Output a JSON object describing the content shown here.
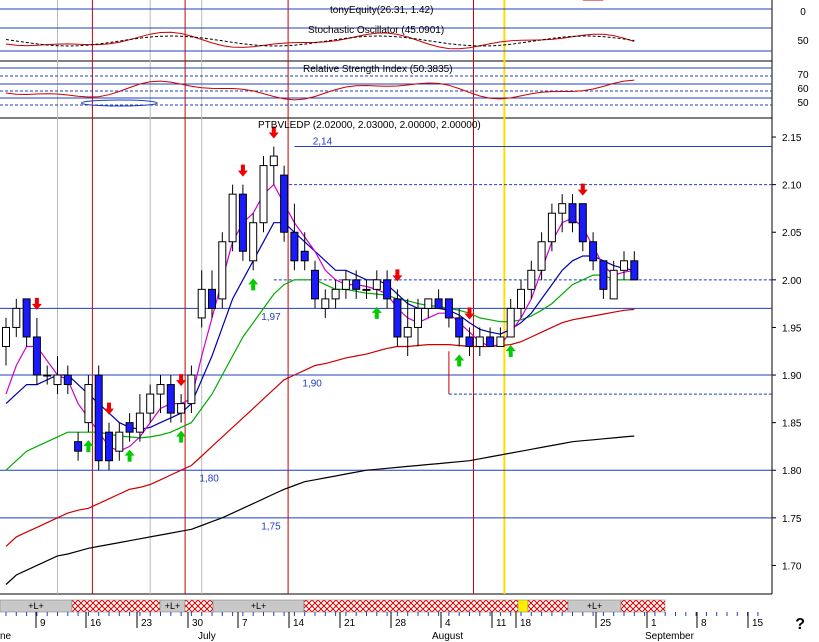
{
  "panels": {
    "equity": {
      "title": "tonyEquity(26.31, 1.42)",
      "scale": [
        "0"
      ]
    },
    "stochastic": {
      "title": "Stochastic Oscillator (45.0901)",
      "scale": [
        "50"
      ]
    },
    "rsi": {
      "title": "Relative Strength Index (50.3835)",
      "scale": [
        "70",
        "60",
        "50"
      ]
    }
  },
  "price_panel": {
    "title": "PTBVLEDP (2.02000, 2.03000, 2.00000, 2.00000)",
    "scale": [
      "2.15",
      "2.10",
      "2.05",
      "2.00",
      "1.95",
      "1.90",
      "1.85",
      "1.80",
      "1.75",
      "1.70"
    ]
  },
  "annotations": [
    {
      "text": "2,14",
      "x_index": 29,
      "y": 2.142
    },
    {
      "text": "1,97",
      "x_index": 24,
      "y": 1.958
    },
    {
      "text": "1,90",
      "x_index": 28,
      "y": 1.888
    },
    {
      "text": "1,80",
      "x_index": 18,
      "y": 1.788
    },
    {
      "text": "1,75",
      "x_index": 24,
      "y": 1.738
    }
  ],
  "date_axis": {
    "day_labels": [
      "9",
      "16",
      "23",
      "30",
      "7",
      "14",
      "21",
      "28",
      "4",
      "11",
      "18",
      "25",
      "1",
      "8",
      "15"
    ],
    "month_labels": [
      "ne",
      "July",
      "August",
      "September"
    ],
    "question_mark": "?"
  },
  "trade_bar": {
    "long_label": "+L+"
  },
  "colors": {
    "up": "#ffffff",
    "down": "#1a1aff",
    "up_arrow": "#00cc00",
    "down_arrow": "#ee0000",
    "ma_black": "#000000",
    "ma_red": "#cc0000",
    "ma_green": "#00aa00",
    "ma_blue": "#0000aa",
    "ma_magenta": "#cc00cc"
  },
  "chart_data": {
    "type": "candlestick",
    "title": "PTBVLEDP (2.02000, 2.03000, 2.00000, 2.00000)",
    "ylim": [
      1.67,
      2.17
    ],
    "horizontal_levels": [
      2.14,
      2.1,
      2.0,
      1.97,
      1.9,
      1.88,
      1.8,
      1.75
    ],
    "candles": [
      {
        "o": 1.93,
        "h": 1.96,
        "l": 1.91,
        "c": 1.95
      },
      {
        "o": 1.95,
        "h": 1.98,
        "l": 1.94,
        "c": 1.97
      },
      {
        "o": 1.98,
        "h": 1.98,
        "l": 1.93,
        "c": 1.94
      },
      {
        "o": 1.94,
        "h": 1.96,
        "l": 1.89,
        "c": 1.9
      },
      {
        "o": 1.9,
        "h": 1.91,
        "l": 1.89,
        "c": 1.9
      },
      {
        "o": 1.89,
        "h": 1.92,
        "l": 1.88,
        "c": 1.9
      },
      {
        "o": 1.9,
        "h": 1.91,
        "l": 1.88,
        "c": 1.89
      },
      {
        "o": 1.83,
        "h": 1.84,
        "l": 1.81,
        "c": 1.82
      },
      {
        "o": 1.85,
        "h": 1.9,
        "l": 1.84,
        "c": 1.89
      },
      {
        "o": 1.9,
        "h": 1.91,
        "l": 1.8,
        "c": 1.81
      },
      {
        "o": 1.84,
        "h": 1.85,
        "l": 1.8,
        "c": 1.81
      },
      {
        "o": 1.82,
        "h": 1.85,
        "l": 1.81,
        "c": 1.84
      },
      {
        "o": 1.85,
        "h": 1.86,
        "l": 1.83,
        "c": 1.84
      },
      {
        "o": 1.84,
        "h": 1.88,
        "l": 1.83,
        "c": 1.86
      },
      {
        "o": 1.86,
        "h": 1.89,
        "l": 1.85,
        "c": 1.88
      },
      {
        "o": 1.88,
        "h": 1.9,
        "l": 1.86,
        "c": 1.89
      },
      {
        "o": 1.89,
        "h": 1.9,
        "l": 1.85,
        "c": 1.86
      },
      {
        "o": 1.86,
        "h": 1.88,
        "l": 1.85,
        "c": 1.87
      },
      {
        "o": 1.87,
        "h": 1.91,
        "l": 1.86,
        "c": 1.9
      },
      {
        "o": 1.96,
        "h": 2.01,
        "l": 1.95,
        "c": 1.99
      },
      {
        "o": 1.99,
        "h": 2.01,
        "l": 1.96,
        "c": 1.97
      },
      {
        "o": 1.98,
        "h": 2.05,
        "l": 1.97,
        "c": 2.04
      },
      {
        "o": 2.04,
        "h": 2.1,
        "l": 2.03,
        "c": 2.09
      },
      {
        "o": 2.09,
        "h": 2.1,
        "l": 2.02,
        "c": 2.03
      },
      {
        "o": 2.02,
        "h": 2.07,
        "l": 2.01,
        "c": 2.06
      },
      {
        "o": 2.06,
        "h": 2.13,
        "l": 2.05,
        "c": 2.12
      },
      {
        "o": 2.12,
        "h": 2.14,
        "l": 2.1,
        "c": 2.13
      },
      {
        "o": 2.11,
        "h": 2.12,
        "l": 2.04,
        "c": 2.05
      },
      {
        "o": 2.05,
        "h": 2.08,
        "l": 2.01,
        "c": 2.02
      },
      {
        "o": 2.03,
        "h": 2.05,
        "l": 2.01,
        "c": 2.02
      },
      {
        "o": 2.01,
        "h": 2.02,
        "l": 1.97,
        "c": 1.98
      },
      {
        "o": 1.97,
        "h": 1.99,
        "l": 1.96,
        "c": 1.98
      },
      {
        "o": 1.98,
        "h": 2.0,
        "l": 1.97,
        "c": 1.99
      },
      {
        "o": 1.99,
        "h": 2.01,
        "l": 1.98,
        "c": 2.0
      },
      {
        "o": 2.0,
        "h": 2.01,
        "l": 1.98,
        "c": 1.99
      },
      {
        "o": 1.99,
        "h": 2.0,
        "l": 1.98,
        "c": 1.99
      },
      {
        "o": 1.99,
        "h": 2.01,
        "l": 1.98,
        "c": 2.0
      },
      {
        "o": 2.0,
        "h": 2.01,
        "l": 1.97,
        "c": 1.98
      },
      {
        "o": 1.98,
        "h": 1.99,
        "l": 1.93,
        "c": 1.94
      },
      {
        "o": 1.94,
        "h": 1.98,
        "l": 1.92,
        "c": 1.95
      },
      {
        "o": 1.95,
        "h": 1.98,
        "l": 1.93,
        "c": 1.97
      },
      {
        "o": 1.97,
        "h": 1.98,
        "l": 1.96,
        "c": 1.98
      },
      {
        "o": 1.98,
        "h": 1.99,
        "l": 1.97,
        "c": 1.97
      },
      {
        "o": 1.98,
        "h": 1.98,
        "l": 1.95,
        "c": 1.96
      },
      {
        "o": 1.96,
        "h": 1.97,
        "l": 1.93,
        "c": 1.94
      },
      {
        "o": 1.94,
        "h": 1.95,
        "l": 1.92,
        "c": 1.93
      },
      {
        "o": 1.93,
        "h": 1.95,
        "l": 1.92,
        "c": 1.94
      },
      {
        "o": 1.94,
        "h": 1.95,
        "l": 1.93,
        "c": 1.93
      },
      {
        "o": 1.93,
        "h": 1.95,
        "l": 1.93,
        "c": 1.94
      },
      {
        "o": 1.94,
        "h": 1.98,
        "l": 1.94,
        "c": 1.97
      },
      {
        "o": 1.97,
        "h": 2.0,
        "l": 1.96,
        "c": 1.99
      },
      {
        "o": 1.99,
        "h": 2.02,
        "l": 1.98,
        "c": 2.01
      },
      {
        "o": 2.01,
        "h": 2.05,
        "l": 2.0,
        "c": 2.04
      },
      {
        "o": 2.04,
        "h": 2.08,
        "l": 2.03,
        "c": 2.07
      },
      {
        "o": 2.07,
        "h": 2.09,
        "l": 2.05,
        "c": 2.08
      },
      {
        "o": 2.08,
        "h": 2.09,
        "l": 2.05,
        "c": 2.06
      },
      {
        "o": 2.08,
        "h": 2.08,
        "l": 2.03,
        "c": 2.04
      },
      {
        "o": 2.04,
        "h": 2.05,
        "l": 2.01,
        "c": 2.02
      },
      {
        "o": 2.02,
        "h": 2.02,
        "l": 1.98,
        "c": 1.99
      },
      {
        "o": 1.98,
        "h": 2.02,
        "l": 1.98,
        "c": 2.01
      },
      {
        "o": 2.01,
        "h": 2.03,
        "l": 2.0,
        "c": 2.02
      },
      {
        "o": 2.02,
        "h": 2.03,
        "l": 2.0,
        "c": 2.0
      }
    ],
    "up_arrows": [
      8,
      12,
      17,
      24,
      36,
      44,
      49
    ],
    "down_arrows": [
      3,
      10,
      17,
      23,
      26,
      38,
      45,
      56
    ],
    "vertical_markers_red": [
      8,
      17,
      27,
      45
    ],
    "vertical_marker_yellow": 48,
    "ma_black": [
      1.68,
      1.69,
      1.695,
      1.7,
      1.705,
      1.71,
      1.712,
      1.715,
      1.718,
      1.72,
      1.722,
      1.724,
      1.726,
      1.728,
      1.73,
      1.732,
      1.734,
      1.736,
      1.738,
      1.742,
      1.746,
      1.75,
      1.755,
      1.76,
      1.765,
      1.77,
      1.775,
      1.78,
      1.784,
      1.788,
      1.79,
      1.792,
      1.794,
      1.796,
      1.798,
      1.8,
      1.801,
      1.802,
      1.803,
      1.804,
      1.805,
      1.806,
      1.807,
      1.808,
      1.809,
      1.81,
      1.812,
      1.814,
      1.816,
      1.818,
      1.82,
      1.822,
      1.824,
      1.826,
      1.828,
      1.83,
      1.831,
      1.832,
      1.833,
      1.834,
      1.835,
      1.836
    ],
    "ma_red": [
      1.72,
      1.73,
      1.735,
      1.74,
      1.745,
      1.75,
      1.755,
      1.758,
      1.76,
      1.765,
      1.77,
      1.775,
      1.78,
      1.782,
      1.785,
      1.79,
      1.795,
      1.8,
      1.805,
      1.815,
      1.825,
      1.835,
      1.845,
      1.855,
      1.865,
      1.875,
      1.885,
      1.895,
      1.9,
      1.905,
      1.91,
      1.912,
      1.915,
      1.918,
      1.92,
      1.922,
      1.925,
      1.928,
      1.93,
      1.93,
      1.931,
      1.932,
      1.932,
      1.932,
      1.931,
      1.93,
      1.93,
      1.93,
      1.931,
      1.932,
      1.935,
      1.94,
      1.945,
      1.95,
      1.955,
      1.958,
      1.96,
      1.962,
      1.964,
      1.966,
      1.968,
      1.969
    ],
    "ma_green": [
      1.8,
      1.81,
      1.82,
      1.825,
      1.83,
      1.835,
      1.84,
      1.84,
      1.84,
      1.84,
      1.838,
      1.836,
      1.835,
      1.834,
      1.835,
      1.837,
      1.84,
      1.845,
      1.85,
      1.865,
      1.88,
      1.9,
      1.92,
      1.94,
      1.955,
      1.97,
      1.985,
      1.995,
      2.0,
      2.0,
      2.0,
      1.995,
      1.99,
      1.99,
      1.988,
      1.986,
      1.985,
      1.984,
      1.98,
      1.978,
      1.975,
      1.973,
      1.972,
      1.97,
      1.968,
      1.965,
      1.96,
      1.958,
      1.956,
      1.956,
      1.958,
      1.962,
      1.968,
      1.975,
      1.985,
      1.995,
      2.0,
      2.005,
      2.005,
      2.0,
      2.0,
      2.0
    ],
    "ma_blue": [
      1.87,
      1.88,
      1.89,
      1.89,
      1.895,
      1.9,
      1.9,
      1.89,
      1.88,
      1.87,
      1.86,
      1.85,
      1.845,
      1.843,
      1.845,
      1.85,
      1.855,
      1.86,
      1.87,
      1.895,
      1.92,
      1.95,
      1.98,
      2.0,
      2.02,
      2.04,
      2.06,
      2.06,
      2.05,
      2.04,
      2.03,
      2.02,
      2.01,
      2.01,
      2.005,
      2.0,
      2.0,
      1.995,
      1.985,
      1.975,
      1.97,
      1.97,
      1.97,
      1.968,
      1.963,
      1.955,
      1.948,
      1.945,
      1.943,
      1.948,
      1.955,
      1.965,
      1.98,
      1.995,
      2.01,
      2.02,
      2.025,
      2.025,
      2.02,
      2.015,
      2.012,
      2.01
    ],
    "ma_magenta": [
      1.88,
      1.91,
      1.93,
      1.93,
      1.915,
      1.9,
      1.895,
      1.87,
      1.855,
      1.84,
      1.825,
      1.82,
      1.825,
      1.835,
      1.85,
      1.865,
      1.87,
      1.87,
      1.875,
      1.92,
      1.96,
      2.0,
      2.04,
      2.06,
      2.07,
      2.09,
      2.1,
      2.08,
      2.06,
      2.045,
      2.03,
      2.01,
      2.0,
      1.995,
      1.995,
      1.993,
      1.99,
      1.985,
      1.97,
      1.96,
      1.955,
      1.96,
      1.965,
      1.965,
      1.955,
      1.945,
      1.935,
      1.93,
      1.932,
      1.945,
      1.96,
      1.98,
      2.01,
      2.04,
      2.06,
      2.065,
      2.055,
      2.035,
      2.015,
      2.005,
      2.008,
      2.01
    ]
  }
}
